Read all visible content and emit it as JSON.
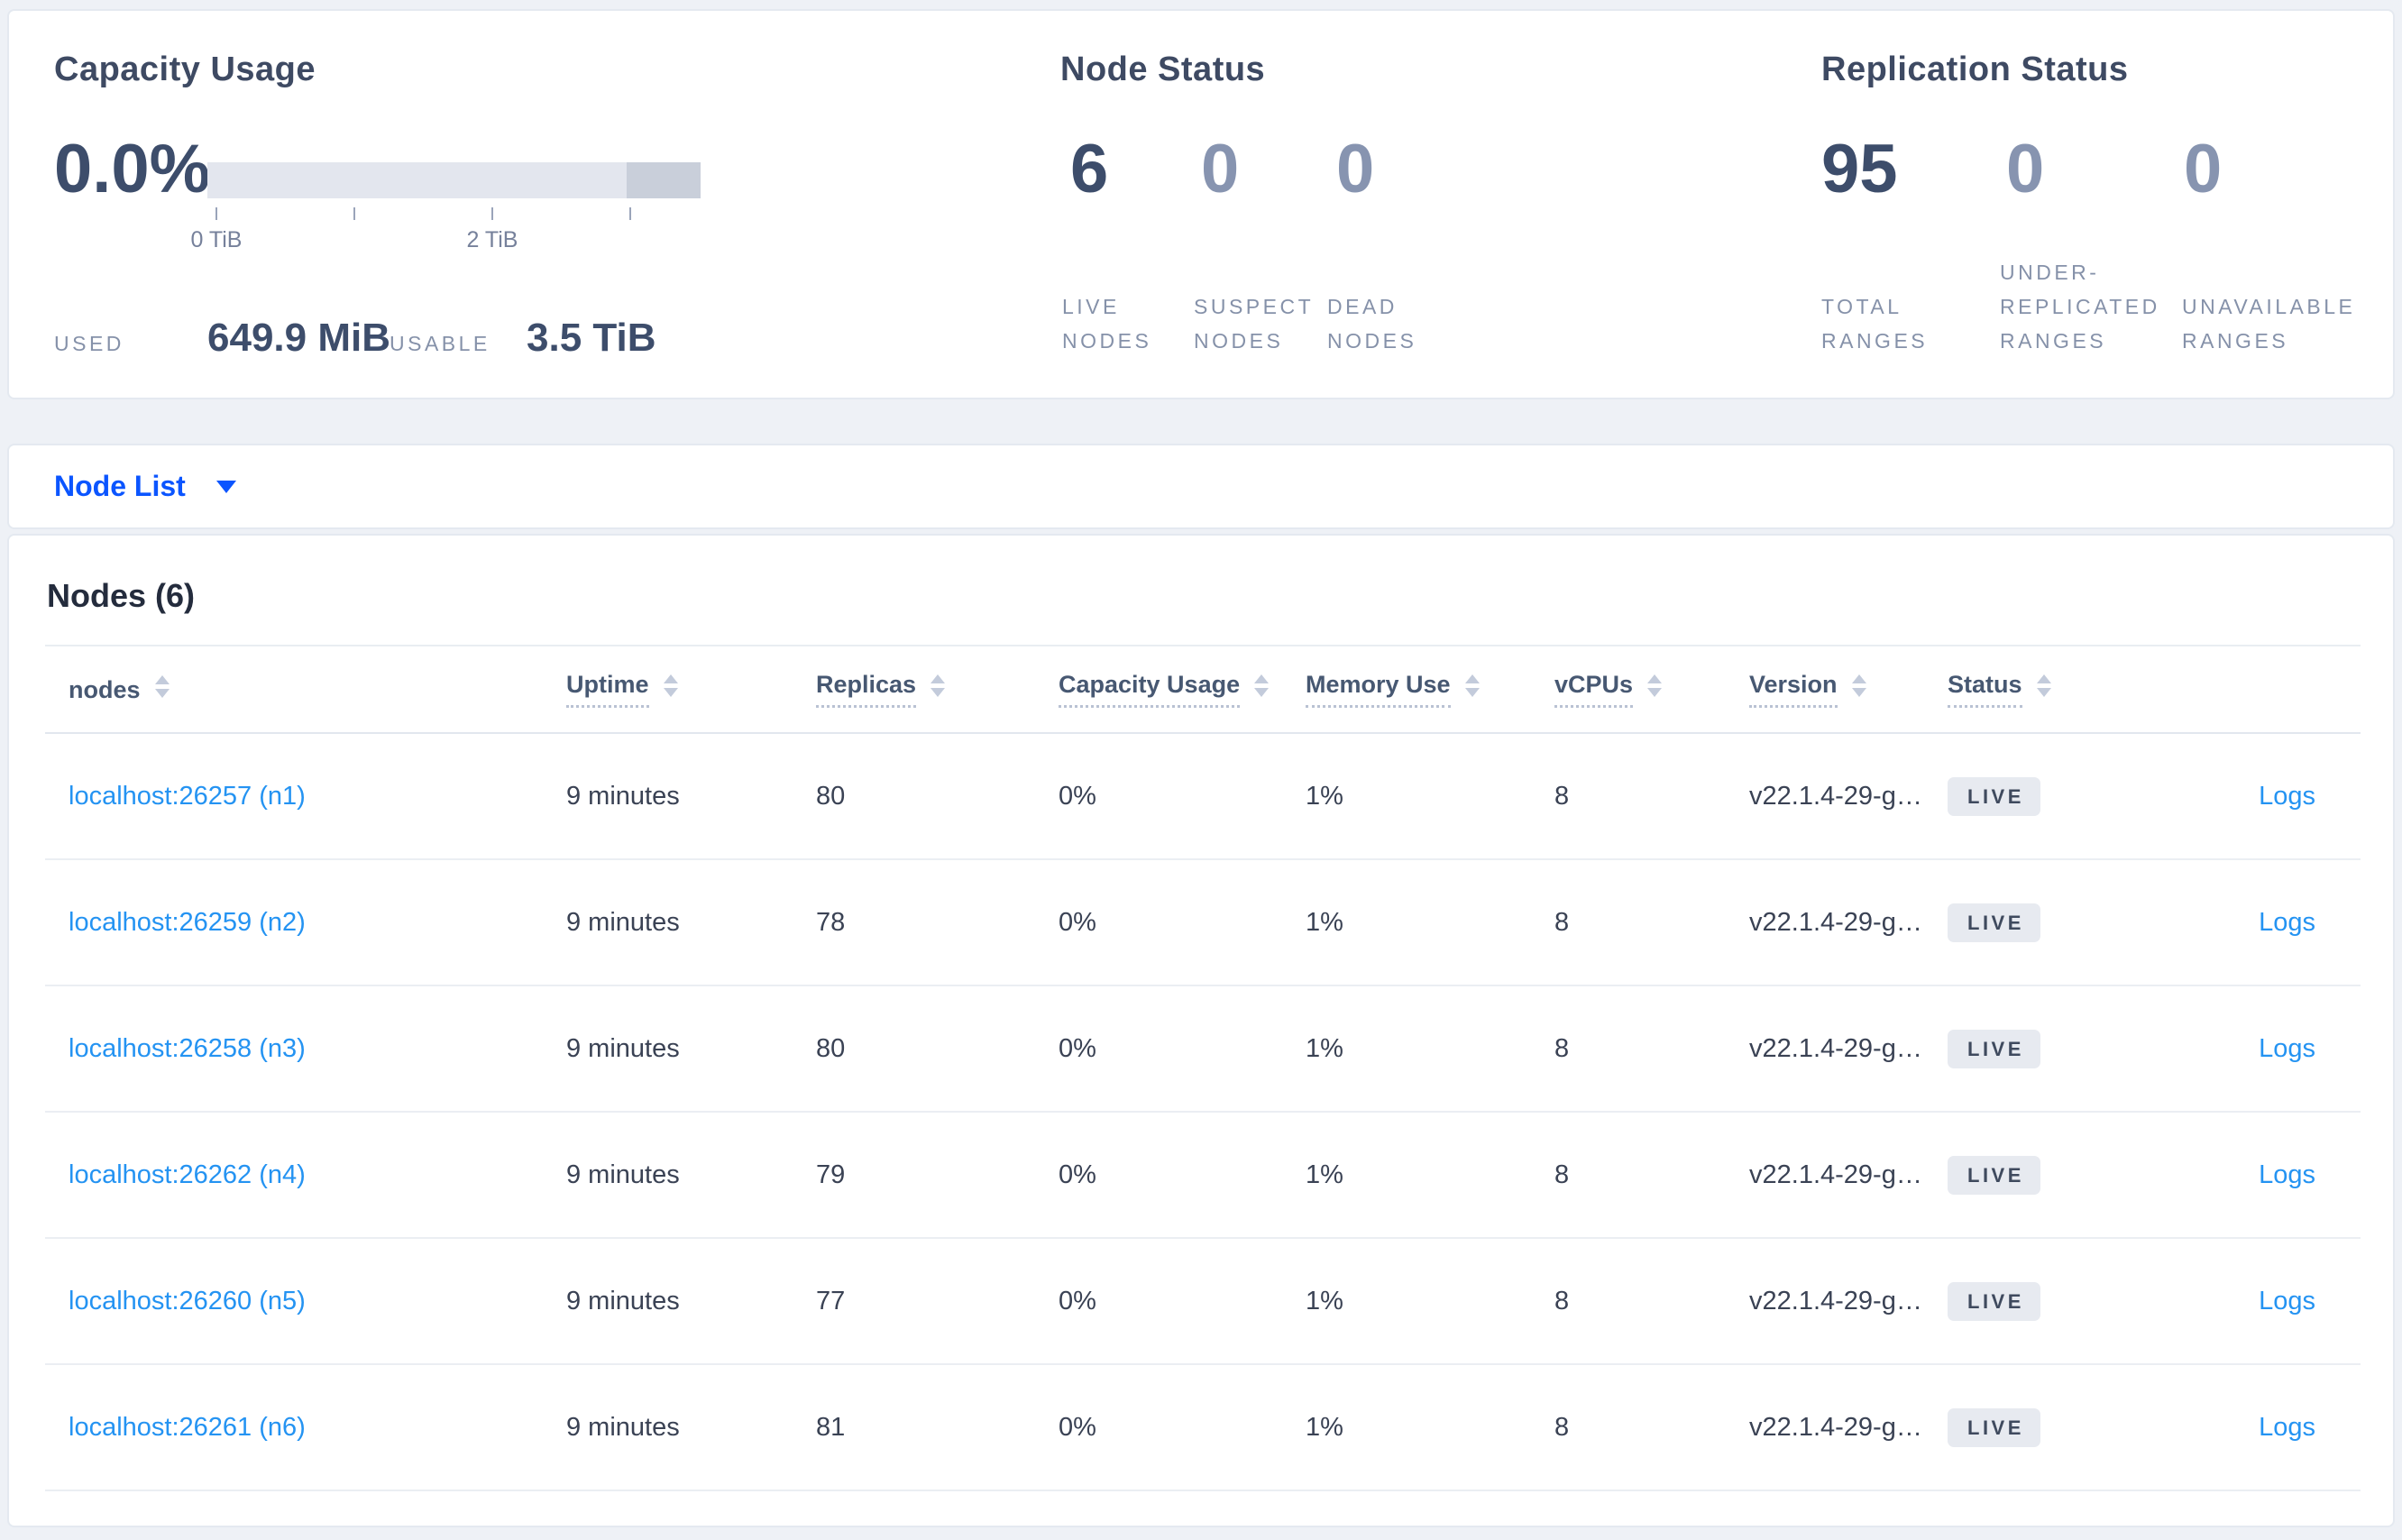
{
  "summary": {
    "capacity": {
      "title": "Capacity Usage",
      "percent": "0.0%",
      "tick_labels": [
        "0 TiB",
        "2 TiB"
      ],
      "used_label": "USED",
      "used_value": "649.9 MiB",
      "usable_label": "USABLE",
      "usable_value": "3.5 TiB"
    },
    "node_status": {
      "title": "Node Status",
      "stats": [
        {
          "value": "6",
          "label": "LIVE NODES"
        },
        {
          "value": "0",
          "label": "SUSPECT NODES"
        },
        {
          "value": "0",
          "label": "DEAD NODES"
        }
      ]
    },
    "replication": {
      "title": "Replication Status",
      "stats": [
        {
          "value": "95",
          "label": "TOTAL RANGES"
        },
        {
          "value": "0",
          "label": "UNDER-REPLICATED RANGES"
        },
        {
          "value": "0",
          "label": "UNAVAILABLE RANGES"
        }
      ]
    }
  },
  "view_switcher": {
    "label": "Node List",
    "icon": "caret-down-icon"
  },
  "table": {
    "heading": "Nodes (6)",
    "columns": [
      {
        "label": "nodes"
      },
      {
        "label": "Uptime"
      },
      {
        "label": "Replicas"
      },
      {
        "label": "Capacity Usage"
      },
      {
        "label": "Memory Use"
      },
      {
        "label": "vCPUs"
      },
      {
        "label": "Version"
      },
      {
        "label": "Status"
      }
    ],
    "rows": [
      {
        "node": "localhost:26257 (n1)",
        "uptime": "9 minutes",
        "replicas": "80",
        "capacity": "0%",
        "memory": "1%",
        "vcpus": "8",
        "version": "v22.1.4-29-g…",
        "status": "LIVE",
        "logs": "Logs"
      },
      {
        "node": "localhost:26259 (n2)",
        "uptime": "9 minutes",
        "replicas": "78",
        "capacity": "0%",
        "memory": "1%",
        "vcpus": "8",
        "version": "v22.1.4-29-g…",
        "status": "LIVE",
        "logs": "Logs"
      },
      {
        "node": "localhost:26258 (n3)",
        "uptime": "9 minutes",
        "replicas": "80",
        "capacity": "0%",
        "memory": "1%",
        "vcpus": "8",
        "version": "v22.1.4-29-g…",
        "status": "LIVE",
        "logs": "Logs"
      },
      {
        "node": "localhost:26262 (n4)",
        "uptime": "9 minutes",
        "replicas": "79",
        "capacity": "0%",
        "memory": "1%",
        "vcpus": "8",
        "version": "v22.1.4-29-g…",
        "status": "LIVE",
        "logs": "Logs"
      },
      {
        "node": "localhost:26260 (n5)",
        "uptime": "9 minutes",
        "replicas": "77",
        "capacity": "0%",
        "memory": "1%",
        "vcpus": "8",
        "version": "v22.1.4-29-g…",
        "status": "LIVE",
        "logs": "Logs"
      },
      {
        "node": "localhost:26261 (n6)",
        "uptime": "9 minutes",
        "replicas": "81",
        "capacity": "0%",
        "memory": "1%",
        "vcpus": "8",
        "version": "v22.1.4-29-g…",
        "status": "LIVE",
        "logs": "Logs"
      }
    ]
  },
  "colors": {
    "bg": "#eef1f6",
    "card-border": "#e4e9f0",
    "heading": "#3e4a63",
    "dark-number": "#3d4d6b",
    "light-number": "#8794b0",
    "muted-label": "#8591a9",
    "link-light": "#2493f2",
    "link-primary": "#0b55ff",
    "badge-bg": "#e7eaf0",
    "badge-text": "#3f4a5e",
    "bar-light": "#e3e6ee",
    "bar-dark": "#c9cfda"
  }
}
